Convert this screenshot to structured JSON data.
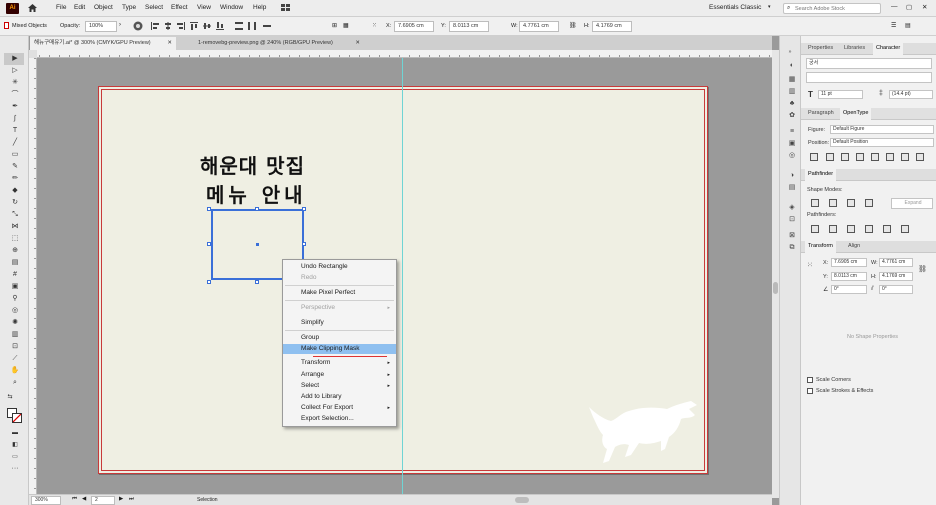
{
  "app": {
    "logo": "Ai"
  },
  "menu": [
    "File",
    "Edit",
    "Object",
    "Type",
    "Select",
    "Effect",
    "View",
    "Window",
    "Help"
  ],
  "workspace": "Essentials Classic",
  "search": {
    "placeholder": "Search Adobe Stock"
  },
  "control": {
    "mixed_objects": "Mixed Objects",
    "opacity_label": "Opacity:",
    "opacity_value": "100%",
    "x_label": "X:",
    "x_value": "7.6905 cm",
    "y_label": "Y:",
    "y_value": "8.0113 cm",
    "w_label": "W:",
    "w_value": "4.7761 cm",
    "h_label": "H:",
    "h_value": "4.1769 cm"
  },
  "tabs": [
    {
      "label": "해뉴구매유기.ai* @ 300% (CMYK/GPU Preview)",
      "active": true
    },
    {
      "label": "1-removebg-preview.png @ 240% (RGB/GPU Preview)",
      "active": false
    }
  ],
  "artboard": {
    "title": "해운대 맛집",
    "subtitle": "메뉴 안내"
  },
  "context_menu": {
    "items": [
      {
        "label": "Undo Rectangle",
        "enabled": true,
        "submenu": false
      },
      {
        "label": "Redo",
        "enabled": false,
        "submenu": false
      },
      {
        "label": "Make Pixel Perfect",
        "enabled": true,
        "submenu": false
      },
      {
        "label": "Perspective",
        "enabled": false,
        "submenu": true
      },
      {
        "label": "Simplify",
        "enabled": true,
        "submenu": false
      },
      {
        "label": "Group",
        "enabled": true,
        "submenu": false
      },
      {
        "label": "Make Clipping Mask",
        "enabled": true,
        "submenu": false,
        "highlighted": true
      },
      {
        "label": "Transform",
        "enabled": true,
        "submenu": true
      },
      {
        "label": "Arrange",
        "enabled": true,
        "submenu": true
      },
      {
        "label": "Select",
        "enabled": true,
        "submenu": true
      },
      {
        "label": "Add to Library",
        "enabled": true,
        "submenu": false
      },
      {
        "label": "Collect For Export",
        "enabled": true,
        "submenu": true
      },
      {
        "label": "Export Selection...",
        "enabled": true,
        "submenu": false
      }
    ]
  },
  "status": {
    "zoom": "300%",
    "artboard_num": "2",
    "mode": "Selection"
  },
  "panel": {
    "top_tabs": [
      "Properties",
      "Libraries",
      "Character"
    ],
    "font_family": "궁서",
    "font_size": "11 pt",
    "leading": "(14.4 pt)",
    "sub_tabs": [
      "Paragraph",
      "OpenType"
    ],
    "figure_label": "Figure:",
    "figure_value": "Default Figure",
    "position_label": "Position:",
    "position_value": "Default Position",
    "pathfinder": {
      "title": "Pathfinder",
      "shape_modes": "Shape Modes:",
      "expand": "Expand",
      "pathfinders": "Pathfinders:"
    },
    "transform": {
      "tabs": [
        "Transform",
        "Align"
      ],
      "x_label": "X:",
      "x_value": "7.6905 cm",
      "y_label": "Y:",
      "y_value": "8.0113 cm",
      "w_label": "W:",
      "w_value": "4.7761 cm",
      "h_label": "H:",
      "h_value": "4.1769 cm",
      "angle": "0°",
      "shear": "0°",
      "no_shape": "No Shape Properties",
      "scale_corners": "Scale Corners",
      "scale_strokes": "Scale Strokes & Effects"
    }
  }
}
